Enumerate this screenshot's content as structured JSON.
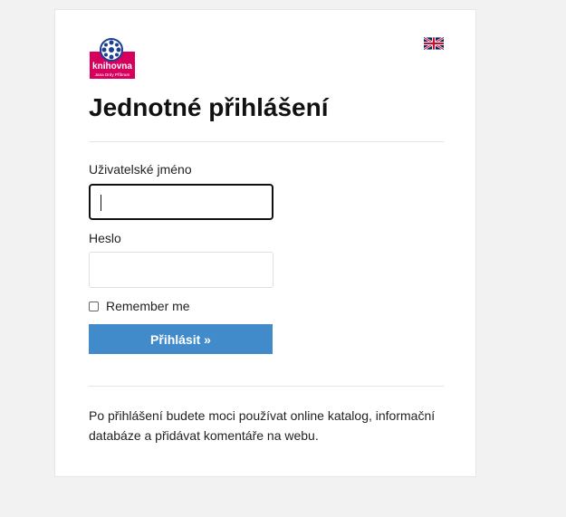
{
  "logo": {
    "text": "knihovna",
    "subtitle": "Jana Drdy Příbram"
  },
  "language": {
    "flag": "uk-flag-icon"
  },
  "title": "Jednotné přihlášení",
  "form": {
    "username_label": "Uživatelské jméno",
    "username_value": "",
    "password_label": "Heslo",
    "password_value": "",
    "remember_label": "Remember me",
    "remember_checked": false,
    "submit_label": "Přihlásit »"
  },
  "info": "Po přihlášení budete moci používat online katalog, informační databáze a přidávat komentáře na webu.",
  "colors": {
    "primary_button": "#428bca",
    "logo_pink": "#d6005c",
    "logo_blue": "#1c3f94"
  }
}
